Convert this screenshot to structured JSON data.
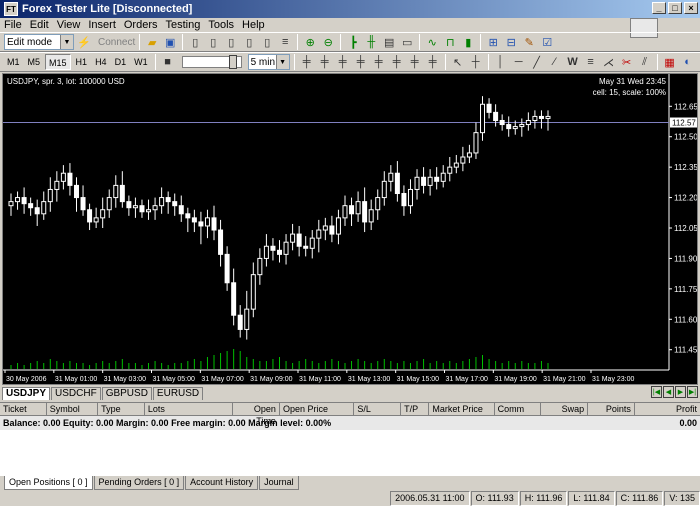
{
  "window": {
    "title": "Forex Tester Lite [Disconnected]",
    "app_icon": "FT"
  },
  "menu": [
    "File",
    "Edit",
    "View",
    "Insert",
    "Orders",
    "Testing",
    "Tools",
    "Help"
  ],
  "toolbar": {
    "mode_select": "Edit mode",
    "connect_label": "Connect",
    "timeframes": [
      "M1",
      "M5",
      "M15",
      "H1",
      "H4",
      "D1",
      "W1"
    ],
    "active_timeframe": "M15",
    "speed_select": "5 min"
  },
  "chart": {
    "info": "USDJPY, spr. 3, lot: 100000 USD",
    "datetime": "May 31 Wed 23:45",
    "cellscale": "cell: 15, scale: 100%",
    "current_price": "112.57",
    "price_ticks": [
      "112.65",
      "112.50",
      "112.35",
      "112.20",
      "112.05",
      "111.90",
      "111.75",
      "111.60",
      "111.45"
    ],
    "time_ticks": [
      "30 May 2006",
      "31 May 01:00",
      "31 May 03:00",
      "31 May 05:00",
      "31 May 07:00",
      "31 May 09:00",
      "31 May 11:00",
      "31 May 13:00",
      "31 May 15:00",
      "31 May 17:00",
      "31 May 19:00",
      "31 May 21:00",
      "31 May 23:00"
    ],
    "colors": {
      "bg": "#000000",
      "candle": "#ffffff",
      "volume": "#00c000",
      "axis": "#ffffff"
    }
  },
  "chart_data": {
    "type": "candlestick",
    "ylim": [
      111.35,
      112.75
    ],
    "price_ticks": [
      112.65,
      112.5,
      112.35,
      112.2,
      112.05,
      111.9,
      111.75,
      111.6,
      111.45
    ],
    "current_price": 112.57,
    "close": [
      112.18,
      112.2,
      112.17,
      112.15,
      112.12,
      112.18,
      112.24,
      112.28,
      112.32,
      112.26,
      112.2,
      112.14,
      112.08,
      112.1,
      112.14,
      112.2,
      112.26,
      112.18,
      112.15,
      112.16,
      112.13,
      112.14,
      112.16,
      112.2,
      112.18,
      112.16,
      112.12,
      112.1,
      112.08,
      112.06,
      112.1,
      112.04,
      111.92,
      111.78,
      111.62,
      111.55,
      111.65,
      111.82,
      111.9,
      111.96,
      111.94,
      111.92,
      111.98,
      112.02,
      111.96,
      111.95,
      112.0,
      112.04,
      112.06,
      112.02,
      112.1,
      112.16,
      112.12,
      112.18,
      112.08,
      112.14,
      112.2,
      112.28,
      112.32,
      112.22,
      112.16,
      112.24,
      112.3,
      112.26,
      112.3,
      112.28,
      112.32,
      112.35,
      112.37,
      112.4,
      112.42,
      112.52,
      112.66,
      112.62,
      112.58,
      112.56,
      112.54,
      112.55,
      112.56,
      112.58,
      112.6,
      112.59,
      112.6
    ],
    "wick_up": [
      0.04,
      0.03,
      0.05,
      0.03,
      0.04,
      0.05,
      0.06,
      0.05,
      0.04,
      0.05,
      0.04,
      0.06,
      0.03,
      0.05,
      0.06,
      0.04,
      0.05,
      0.07,
      0.03,
      0.04,
      0.03,
      0.05,
      0.04,
      0.05,
      0.03,
      0.04,
      0.05,
      0.03,
      0.04,
      0.05,
      0.04,
      0.06,
      0.05,
      0.04,
      0.07,
      0.05,
      0.09,
      0.06,
      0.05,
      0.06,
      0.04,
      0.05,
      0.04,
      0.05,
      0.04,
      0.05,
      0.04,
      0.05,
      0.04,
      0.05,
      0.04,
      0.05,
      0.04,
      0.05,
      0.07,
      0.05,
      0.04,
      0.05,
      0.04,
      0.06,
      0.04,
      0.05,
      0.04,
      0.05,
      0.04,
      0.05,
      0.04,
      0.05,
      0.04,
      0.05,
      0.04,
      0.05,
      0.04,
      0.03,
      0.04,
      0.03,
      0.04,
      0.03,
      0.03,
      0.04,
      0.03,
      0.03,
      0.03
    ],
    "volume": [
      2,
      3,
      2,
      3,
      4,
      3,
      5,
      4,
      3,
      4,
      3,
      3,
      2,
      3,
      4,
      3,
      4,
      5,
      3,
      3,
      2,
      3,
      4,
      3,
      2,
      3,
      3,
      4,
      5,
      4,
      6,
      7,
      8,
      9,
      10,
      9,
      6,
      5,
      4,
      4,
      5,
      6,
      4,
      3,
      4,
      5,
      4,
      3,
      4,
      5,
      4,
      3,
      4,
      5,
      4,
      3,
      4,
      5,
      4,
      3,
      4,
      3,
      4,
      5,
      3,
      4,
      3,
      4,
      3,
      4,
      5,
      6,
      7,
      5,
      4,
      3,
      4,
      3,
      4,
      3,
      3,
      4,
      3
    ]
  },
  "symbol_tabs": [
    "USDJPY",
    "USDCHF",
    "GBPUSD",
    "EURUSD"
  ],
  "active_symbol": "USDJPY",
  "terminal": {
    "columns": [
      "Ticket",
      "Symbol",
      "Type",
      "Lots",
      "Open Time",
      "Open Price",
      "S/L",
      "T/P",
      "Market Price",
      "Comm",
      "Swap",
      "Points",
      "Profit"
    ],
    "balance_line": "Balance: 0.00 Equity: 0.00 Margin: 0.00 Free margin: 0.00 Margin level: 0.00%",
    "balance_profit": "0.00"
  },
  "bottom_tabs": [
    "Open Positions  [ 0 ]",
    "Pending Orders  [ 0 ]",
    "Account History",
    "Journal"
  ],
  "status": [
    "2006.05.31 11:00",
    "O: 111.93",
    "H: 111.96",
    "L: 111.84",
    "C: 111.86",
    "V: 135"
  ]
}
